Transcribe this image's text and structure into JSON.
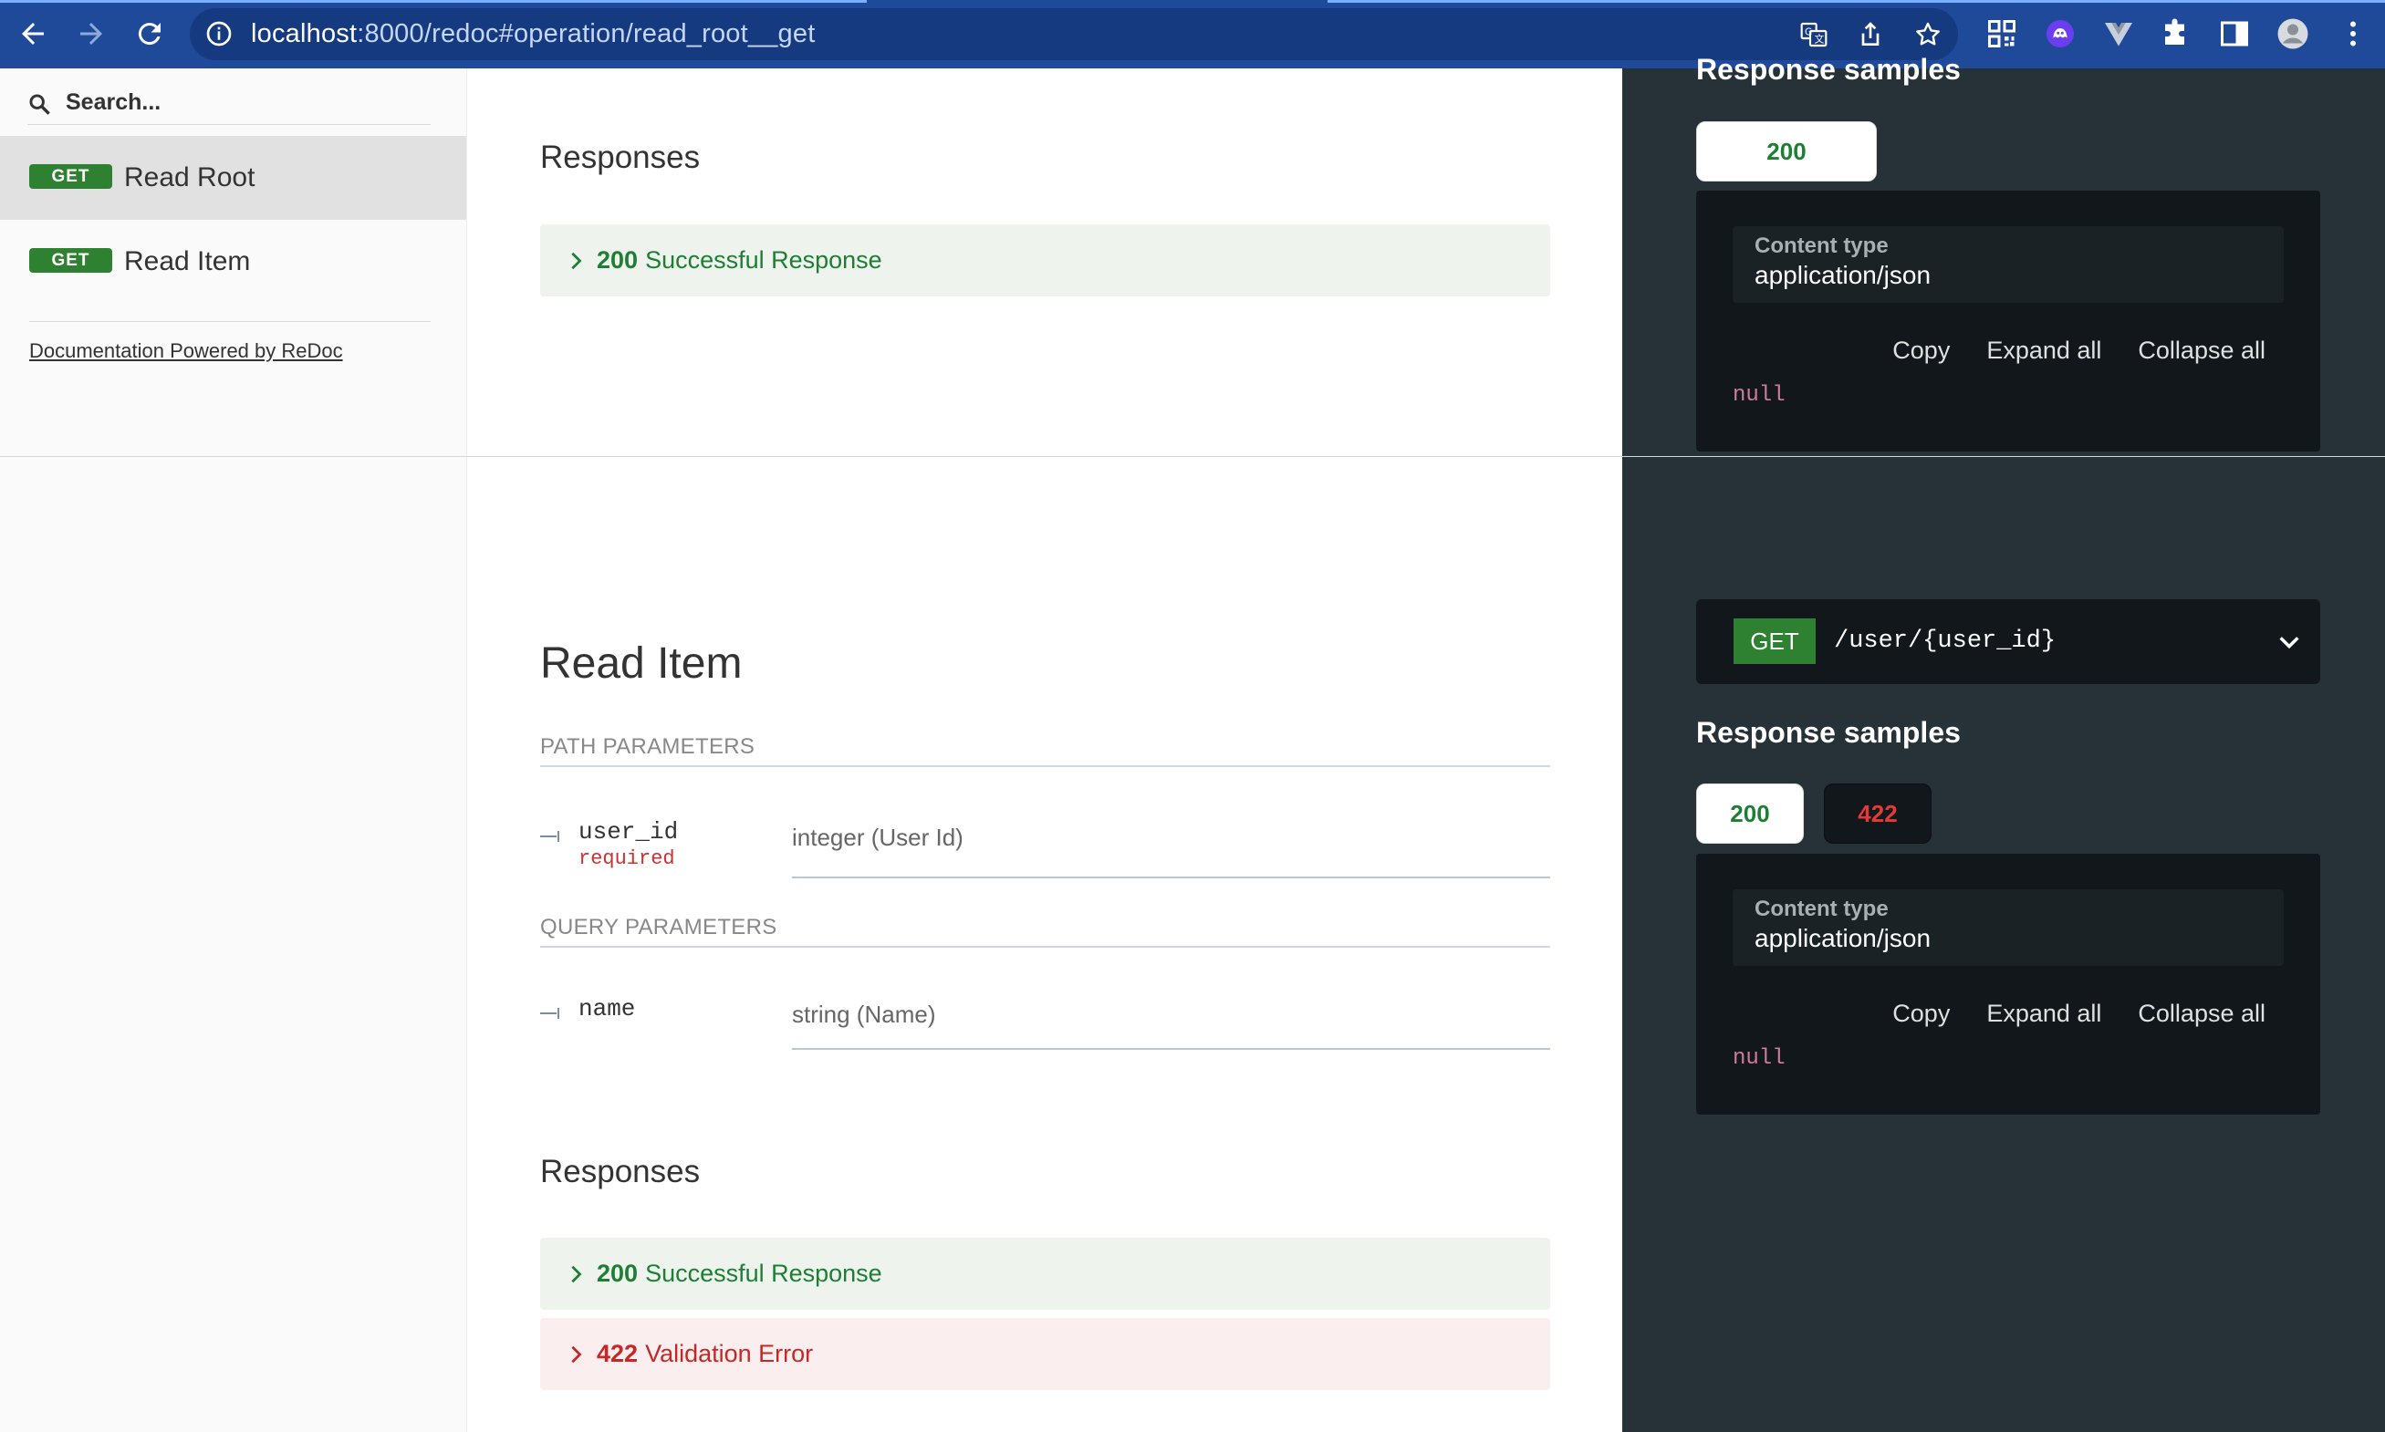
{
  "browser": {
    "url_host": "localhost",
    "url_rest": ":8000/redoc#operation/read_root__get"
  },
  "sidebar": {
    "search_placeholder": "Search...",
    "items": [
      {
        "method": "GET",
        "label": "Read Root"
      },
      {
        "method": "GET",
        "label": "Read Item"
      }
    ],
    "powered_by": "Documentation Powered by ReDoc"
  },
  "read_root": {
    "responses_title": "Responses",
    "responses": [
      {
        "code": "200",
        "label": "Successful Response"
      }
    ],
    "response_samples_title": "Response samples",
    "tabs": [
      "200"
    ],
    "content_type_label": "Content type",
    "content_type_value": "application/json",
    "actions": [
      "Copy",
      "Expand all",
      "Collapse all"
    ],
    "sample_value": "null"
  },
  "read_item": {
    "title": "Read Item",
    "path_params_title": "PATH PARAMETERS",
    "path_params": [
      {
        "name": "user_id",
        "required": "required",
        "type": "integer (User Id)"
      }
    ],
    "query_params_title": "QUERY PARAMETERS",
    "query_params": [
      {
        "name": "name",
        "type": "string (Name)"
      }
    ],
    "responses_title": "Responses",
    "responses": [
      {
        "code": "200",
        "label": "Successful Response"
      },
      {
        "code": "422",
        "label": "Validation Error"
      }
    ],
    "endpoint": {
      "method": "GET",
      "path": "/user/{user_id}"
    },
    "response_samples_title": "Response samples",
    "tabs": [
      "200",
      "422"
    ],
    "content_type_label": "Content type",
    "content_type_value": "application/json",
    "actions": [
      "Copy",
      "Expand all",
      "Collapse all"
    ],
    "sample_value": "null"
  },
  "colors": {
    "toolbar": "#1f4a99",
    "get_badge": "#2f8132",
    "success": "#1e7e34",
    "error": "#c62828",
    "right_panel": "#263238",
    "code_bg": "#11171a"
  },
  "icons": {
    "toolbar": [
      "back-arrow-icon",
      "forward-arrow-icon",
      "reload-icon",
      "info-icon",
      "translate-icon",
      "share-icon",
      "bookmark-star-icon",
      "qr-code-icon",
      "extension-ghost-icon",
      "vue-devtools-icon",
      "puzzle-icon",
      "side-panel-icon",
      "profile-avatar-icon",
      "more-menu-icon"
    ],
    "content": [
      "search-icon",
      "chevron-right-icon",
      "chevron-down-icon",
      "param-tick-icon"
    ]
  }
}
